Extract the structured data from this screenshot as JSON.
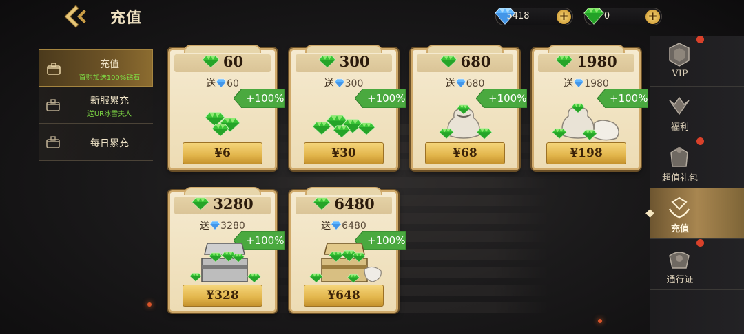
{
  "header": {
    "title": "充值",
    "back_icon": "back-arrow-icon"
  },
  "currencies": [
    {
      "name": "blue-diamond",
      "color": "#5fb6ff",
      "amount": "5418"
    },
    {
      "name": "green-diamond",
      "color": "#39c436",
      "amount": "0"
    }
  ],
  "currency_plus": "+",
  "left_menu": {
    "items": [
      {
        "label": "充值",
        "sub": "首购加送100%钻石",
        "active": true
      },
      {
        "label": "新服累充",
        "sub": "送UR冰雪夫人",
        "active": false
      },
      {
        "label": "每日累充",
        "sub": "",
        "active": false
      }
    ]
  },
  "packs": [
    {
      "gems": "60",
      "bonus": "60",
      "badge": "+100%",
      "price": "¥6",
      "art": "gem-pile"
    },
    {
      "gems": "300",
      "bonus": "300",
      "badge": "+100%",
      "price": "¥30",
      "art": "gem-heap"
    },
    {
      "gems": "680",
      "bonus": "680",
      "badge": "+100%",
      "price": "¥68",
      "art": "gem-bag"
    },
    {
      "gems": "1980",
      "bonus": "1980",
      "badge": "+100%",
      "price": "¥198",
      "art": "gem-bags"
    },
    {
      "gems": "3280",
      "bonus": "3280",
      "badge": "+100%",
      "price": "¥328",
      "art": "gem-chest"
    },
    {
      "gems": "6480",
      "bonus": "6480",
      "badge": "+100%",
      "price": "¥648",
      "art": "gem-gold-chest"
    }
  ],
  "bonus_prefix": "送",
  "right_menu": {
    "items": [
      {
        "label": "VIP",
        "icon": "vip-icon",
        "dot": true,
        "active": false
      },
      {
        "label": "福利",
        "icon": "welfare-icon",
        "dot": false,
        "active": false
      },
      {
        "label": "超值礼包",
        "icon": "gift-pack-icon",
        "dot": true,
        "active": false
      },
      {
        "label": "充值",
        "icon": "recharge-icon",
        "dot": false,
        "active": true
      },
      {
        "label": "通行证",
        "icon": "pass-icon",
        "dot": true,
        "active": false
      }
    ]
  },
  "colors": {
    "accent_gold": "#e2b54b",
    "badge_green": "#4aa93f",
    "gem_green": "#39c436",
    "gem_blue": "#5fb6ff",
    "notify_red": "#d9412a"
  }
}
